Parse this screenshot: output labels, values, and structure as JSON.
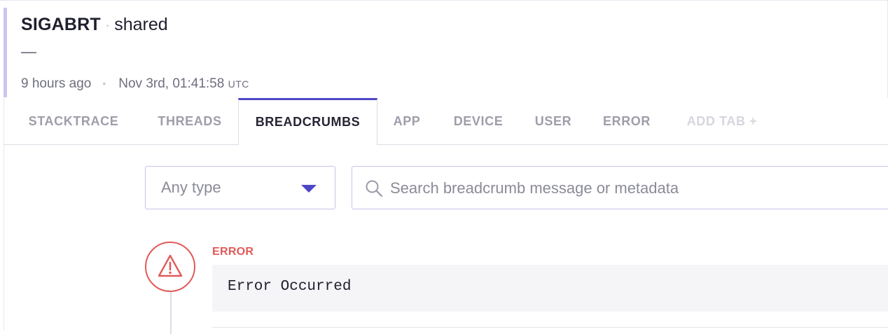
{
  "header": {
    "title": "SIGABRT",
    "separator": "·",
    "subtitle": "shared",
    "dash": "—",
    "relative_time": "9 hours ago",
    "meta_separator": "•",
    "timestamp": "Nov 3rd, 01:41:58",
    "timezone": "UTC",
    "accent_color": "#c9c5ef"
  },
  "tabs": [
    {
      "label": "STACKTRACE",
      "active": false
    },
    {
      "label": "THREADS",
      "active": false
    },
    {
      "label": "BREADCRUMBS",
      "active": true
    },
    {
      "label": "APP",
      "active": false
    },
    {
      "label": "DEVICE",
      "active": false
    },
    {
      "label": "USER",
      "active": false
    },
    {
      "label": "ERROR",
      "active": false
    },
    {
      "label": "ADD TAB +",
      "active": false
    }
  ],
  "filters": {
    "type_select": {
      "value": "Any type",
      "icon": "chevron-down-icon"
    },
    "search": {
      "placeholder": "Search breadcrumb message or metadata",
      "value": "",
      "icon": "search-icon"
    }
  },
  "breadcrumbs": [
    {
      "type": "ERROR",
      "message": "Error Occurred",
      "icon": "warning-icon",
      "color": "#e05a5a"
    }
  ],
  "colors": {
    "accent": "#4f46c6",
    "error": "#e05a5a"
  }
}
